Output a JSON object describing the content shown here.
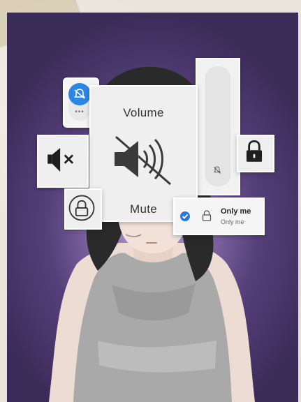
{
  "volume_panel": {
    "title": "Volume",
    "state_label": "Mute"
  },
  "privacy_option": {
    "title": "Only me",
    "subtitle": "Only me",
    "checked": true
  },
  "notification_toggle": {
    "dots": "•••"
  },
  "icons": {
    "muted_speaker_large": "speaker-muted-icon",
    "mute_x": "mute-icon",
    "padlock": "padlock-icon",
    "circle_lock": "lock-circle-icon",
    "bell_off": "bell-off-icon",
    "bell_active": "bell-icon"
  },
  "colors": {
    "accent_blue": "#2b87e5",
    "background_purple": "#55407a"
  }
}
